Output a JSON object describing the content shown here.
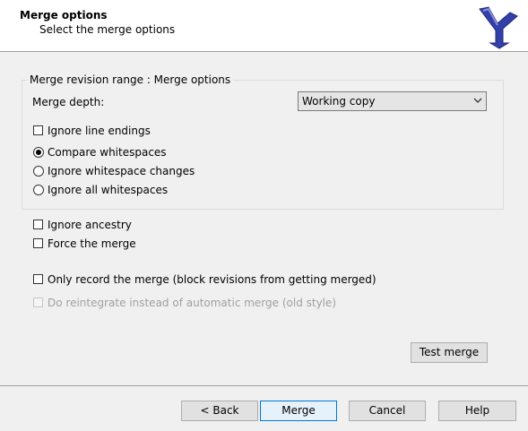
{
  "header": {
    "title": "Merge options",
    "subtitle": "Select the merge options",
    "logo_icon": "tortoisesvn-merge-logo-icon"
  },
  "group": {
    "legend": "Merge revision range : Merge options",
    "depth_label": "Merge depth:",
    "depth_value": "Working copy",
    "ignore_line_endings": {
      "label": "Ignore line endings",
      "checked": false
    },
    "whitespace_options": [
      {
        "label": "Compare whitespaces",
        "selected": true
      },
      {
        "label": "Ignore whitespace changes",
        "selected": false
      },
      {
        "label": "Ignore all whitespaces",
        "selected": false
      }
    ]
  },
  "options": {
    "ignore_ancestry": {
      "label": "Ignore ancestry",
      "checked": false
    },
    "force_merge": {
      "label": "Force the merge",
      "checked": false
    },
    "record_only": {
      "label": "Only record the merge (block revisions from getting merged)",
      "checked": false
    },
    "reintegrate": {
      "label": "Do reintegrate instead of automatic merge (old style)",
      "checked": false,
      "enabled": false
    }
  },
  "buttons": {
    "test_merge": "Test merge",
    "back": "< Back",
    "merge": "Merge",
    "cancel": "Cancel",
    "help": "Help"
  },
  "colors": {
    "logo_blue": "#3340a6",
    "default_button_border": "#0078d7",
    "disabled_text": "#a0a0a0"
  }
}
